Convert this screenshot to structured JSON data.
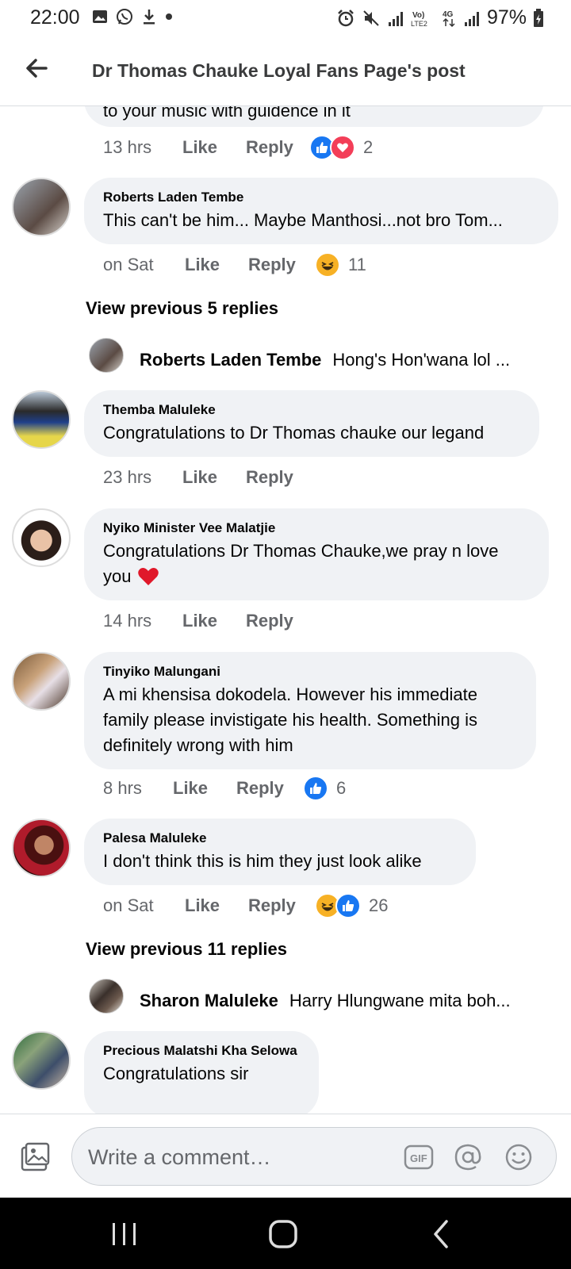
{
  "status_bar": {
    "time": "22:00",
    "battery": "97%",
    "left_icons": [
      "gallery-icon",
      "whatsapp-icon",
      "download-icon",
      "dot-icon"
    ],
    "right_icons": [
      "alarm-icon",
      "mute-icon",
      "signal-icon",
      "volte-icon",
      "4g-icon",
      "signal-icon",
      "battery-icon"
    ]
  },
  "header": {
    "title": "Dr Thomas Chauke Loyal Fans Page's post"
  },
  "labels": {
    "like": "Like",
    "reply": "Reply"
  },
  "comments": [
    {
      "partial_text": "to your music with guidence in it",
      "time": "13 hrs",
      "reactions": [
        "like",
        "love"
      ],
      "reaction_count": "2"
    },
    {
      "author": "Roberts Laden Tembe",
      "text": "This can't be him... Maybe Manthosi...not bro Tom...",
      "time": "on Sat",
      "reactions": [
        "haha"
      ],
      "reaction_count": "11",
      "view_previous": "View previous 5 replies",
      "latest_reply": {
        "author": "Roberts Laden Tembe",
        "text": "Hong's Hon'wana lol ..."
      }
    },
    {
      "author": "Themba Maluleke",
      "text": "Congratulations to Dr Thomas chauke our legand",
      "time": "23 hrs"
    },
    {
      "author": "Nyiko Minister Vee Malatjie",
      "text_line1": "Congratulations Dr Thomas Chauke,we pray n love",
      "text_line2": "you",
      "time": "14 hrs"
    },
    {
      "author": "Tinyiko Malungani",
      "text_line1": "A mi khensisa dokodela. However his immediate",
      "text_line2": "family please invistigate his health. Something is",
      "text_line3": "definitely wrong with him",
      "time": "8 hrs",
      "reactions": [
        "like"
      ],
      "reaction_count": "6"
    },
    {
      "author": "Palesa Maluleke",
      "text": "I don't think this is him they just look alike",
      "time": "on Sat",
      "reactions": [
        "haha",
        "like"
      ],
      "reaction_count": "26",
      "view_previous": "View previous 11 replies",
      "latest_reply": {
        "author": "Sharon Maluleke",
        "text": "Harry Hlungwane mita boh..."
      }
    },
    {
      "author": "Precious Malatshi Kha Selowa",
      "text": "Congratulations sir"
    }
  ],
  "composer": {
    "placeholder": "Write a comment…",
    "icons": [
      "photo-icon",
      "gif-icon",
      "mention-icon",
      "emoji-icon"
    ]
  },
  "colors": {
    "like_blue": "#1877f2",
    "love_red": "#f33e58",
    "haha_yellow": "#f7b125",
    "bubble_bg": "#f0f2f5",
    "meta_gray": "#65676b"
  }
}
